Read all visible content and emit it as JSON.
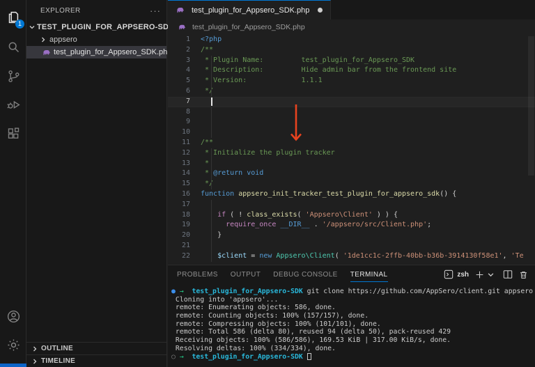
{
  "activity_bar": {
    "badge": "1",
    "icons": [
      "explorer",
      "search",
      "source-control",
      "run-debug",
      "extensions"
    ],
    "bottom_icons": [
      "accounts",
      "settings"
    ]
  },
  "explorer": {
    "title": "EXPLORER",
    "workspace": "TEST_PLUGIN_FOR_APPSERO-SDK",
    "folder": "appsero",
    "file": "test_plugin_for_Appsero_SDK.php",
    "outline": "OUTLINE",
    "timeline": "TIMELINE",
    "more": "···"
  },
  "editor": {
    "tab": "test_plugin_for_Appsero_SDK.php",
    "modified": true,
    "breadcrumb": "test_plugin_for_Appsero_SDK.php",
    "cursor_line": 7,
    "guide_lines": [
      3,
      4,
      5,
      6,
      8,
      9,
      10,
      12,
      13,
      14,
      15,
      17,
      18,
      19,
      20,
      21,
      22
    ],
    "code_lines": [
      [
        [
          "kw",
          "<?php"
        ]
      ],
      [
        [
          "cmt",
          "/**"
        ]
      ],
      [
        [
          "cmt",
          " * Plugin Name:         test_plugin_for_Appsero_SDK"
        ]
      ],
      [
        [
          "cmt",
          " * Description:         Hide admin bar from the frontend site"
        ]
      ],
      [
        [
          "cmt",
          " * Version:             1.1.1"
        ]
      ],
      [
        [
          "cmt",
          " */"
        ]
      ],
      [],
      [],
      [],
      [],
      [
        [
          "cmt",
          "/**"
        ]
      ],
      [
        [
          "cmt",
          " * Initialize the plugin tracker"
        ]
      ],
      [
        [
          "cmt",
          " *"
        ]
      ],
      [
        [
          "cmt",
          " * "
        ],
        [
          "doc",
          "@return void"
        ]
      ],
      [
        [
          "cmt",
          " */"
        ]
      ],
      [
        [
          "kw",
          "function"
        ],
        [
          "pln",
          " "
        ],
        [
          "fn",
          "appsero_init_tracker_test_plugin_for_appsero_sdk"
        ],
        [
          "pln",
          "() {"
        ]
      ],
      [],
      [
        [
          "pln",
          "    "
        ],
        [
          "ctl",
          "if"
        ],
        [
          "pln",
          " ( ! "
        ],
        [
          "fn",
          "class_exists"
        ],
        [
          "pln",
          "( "
        ],
        [
          "str",
          "'Appsero\\Client'"
        ],
        [
          "pln",
          " ) ) {"
        ]
      ],
      [
        [
          "pln",
          "      "
        ],
        [
          "ctl",
          "require_once"
        ],
        [
          "pln",
          " "
        ],
        [
          "kw",
          "__DIR__"
        ],
        [
          "pln",
          " . "
        ],
        [
          "str",
          "'/appsero/src/Client.php'"
        ],
        [
          "pln",
          ";"
        ]
      ],
      [
        [
          "pln",
          "    }"
        ]
      ],
      [],
      [
        [
          "pln",
          "    "
        ],
        [
          "var",
          "$client"
        ],
        [
          "pln",
          " = "
        ],
        [
          "kw",
          "new"
        ],
        [
          "pln",
          " "
        ],
        [
          "cls",
          "Appsero\\Client"
        ],
        [
          "pln",
          "( "
        ],
        [
          "str",
          "'1de1cc1c-2ffb-40bb-b36b-3914130f58e1'"
        ],
        [
          "pln",
          ", "
        ],
        [
          "str",
          "'Te"
        ]
      ]
    ]
  },
  "panel": {
    "tabs": [
      "PROBLEMS",
      "OUTPUT",
      "DEBUG CONSOLE",
      "TERMINAL"
    ],
    "active_tab": "TERMINAL",
    "shell": "zsh",
    "terminal_lines": [
      [
        [
          "dot-blue",
          "●"
        ],
        [
          "pln",
          " "
        ],
        [
          "arrow",
          "→"
        ],
        [
          "pln",
          "  "
        ],
        [
          "dir",
          "test_plugin_for_Appsero-SDK"
        ],
        [
          "pln",
          " git clone https://github.com/AppSero/client.git appsero"
        ]
      ],
      [
        [
          "pln",
          " Cloning into 'appsero'..."
        ]
      ],
      [
        [
          "pln",
          " remote: Enumerating objects: 586, done."
        ]
      ],
      [
        [
          "pln",
          " remote: Counting objects: 100% (157/157), done."
        ]
      ],
      [
        [
          "pln",
          " remote: Compressing objects: 100% (101/101), done."
        ]
      ],
      [
        [
          "pln",
          " remote: Total 586 (delta 80), reused 94 (delta 50), pack-reused 429"
        ]
      ],
      [
        [
          "pln",
          " Receiving objects: 100% (586/586), 169.53 KiB | 317.00 KiB/s, done."
        ]
      ],
      [
        [
          "pln",
          " Resolving deltas: 100% (334/334), done."
        ]
      ],
      [
        [
          "dot-gray",
          "○"
        ],
        [
          "pln",
          " "
        ],
        [
          "arrow",
          "→"
        ],
        [
          "pln",
          "  "
        ],
        [
          "dir",
          "test_plugin_for_Appsero-SDK"
        ],
        [
          "pln",
          " "
        ],
        [
          "cursor",
          ""
        ]
      ]
    ]
  },
  "colors": {
    "accent": "#0078d4",
    "annotation_arrow": "#e8431f",
    "badge": "#0078d4",
    "php_icon": "#9a6fc4",
    "selection_row": "#37373d"
  }
}
